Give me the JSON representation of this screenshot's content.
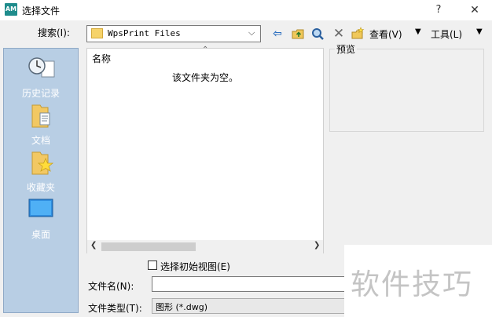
{
  "window": {
    "title": "选择文件",
    "logo": "AM",
    "help": "?",
    "close": "✕"
  },
  "toolbar": {
    "search_label": "搜索(I):",
    "location": "WpsPrint Files",
    "view_label": "查看(V)",
    "tools_label": "工具(L)"
  },
  "places": [
    {
      "label": "历史记录",
      "icon": "history-icon"
    },
    {
      "label": "文档",
      "icon": "documents-icon"
    },
    {
      "label": "收藏夹",
      "icon": "favorites-icon"
    },
    {
      "label": "桌面",
      "icon": "desktop-icon"
    }
  ],
  "file_list": {
    "column_name": "名称",
    "empty_message": "该文件夹为空。"
  },
  "preview": {
    "label": "预览"
  },
  "bottom": {
    "initial_view_label": "选择初始视图(E)",
    "initial_view_checked": false,
    "filename_label": "文件名(N):",
    "filename_value": "",
    "filetype_label": "文件类型(T):",
    "filetype_value": "图形 (*.dwg)"
  },
  "watermark": "软件技巧"
}
